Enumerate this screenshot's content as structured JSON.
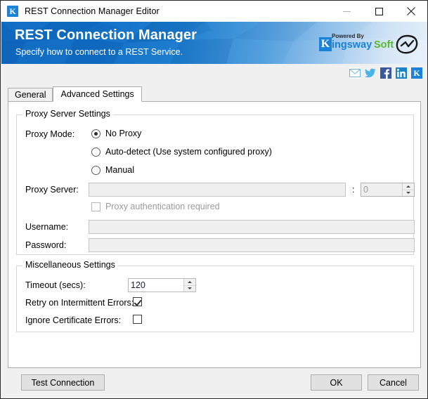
{
  "window": {
    "title": "REST Connection Manager Editor",
    "app_icon": "kingswaysoft-k-icon",
    "minimize_label": "minimize-icon",
    "maximize_label": "maximize-icon",
    "close_label": "close-icon"
  },
  "banner": {
    "title": "REST Connection Manager",
    "subtitle": "Specify how to connect to a REST Service.",
    "logo": {
      "mark": "K",
      "powered_by": "Powered By",
      "name_primary": "ingsway",
      "name_secondary": "Soft",
      "primary_color": "#1a82d8",
      "secondary_color": "#5cb82e"
    },
    "gradient_from": "#0f69c0",
    "gradient_to": "#f2f7fc"
  },
  "social": {
    "items": [
      {
        "name": "email-icon",
        "label": "Email"
      },
      {
        "name": "twitter-icon",
        "label": "Twitter"
      },
      {
        "name": "facebook-icon",
        "label": "Facebook"
      },
      {
        "name": "linkedin-icon",
        "label": "LinkedIn"
      },
      {
        "name": "kingswaysoft-icon",
        "label": "KingswaySoft"
      }
    ]
  },
  "tabs": [
    {
      "label": "General",
      "active": false
    },
    {
      "label": "Advanced Settings",
      "active": true
    }
  ],
  "proxy_group": {
    "legend": "Proxy Server Settings",
    "mode_label": "Proxy Mode:",
    "modes": [
      {
        "label": "No Proxy",
        "selected": true
      },
      {
        "label": "Auto-detect (Use system configured proxy)",
        "selected": false
      },
      {
        "label": "Manual",
        "selected": false
      }
    ],
    "server_label": "Proxy Server:",
    "server_value": "",
    "separator": ":",
    "port_value": "0",
    "auth_checkbox_label": "Proxy authentication required",
    "auth_checked": false,
    "username_label": "Username:",
    "username_value": "",
    "password_label": "Password:",
    "password_value": ""
  },
  "misc_group": {
    "legend": "Miscellaneous Settings",
    "timeout_label": "Timeout (secs):",
    "timeout_value": "120",
    "retry_label": "Retry on Intermittent Errors:",
    "retry_checked": true,
    "ignore_cert_label": "Ignore Certificate Errors:",
    "ignore_cert_checked": false
  },
  "footer": {
    "test_connection_label": "Test Connection",
    "ok_label": "OK",
    "cancel_label": "Cancel"
  }
}
